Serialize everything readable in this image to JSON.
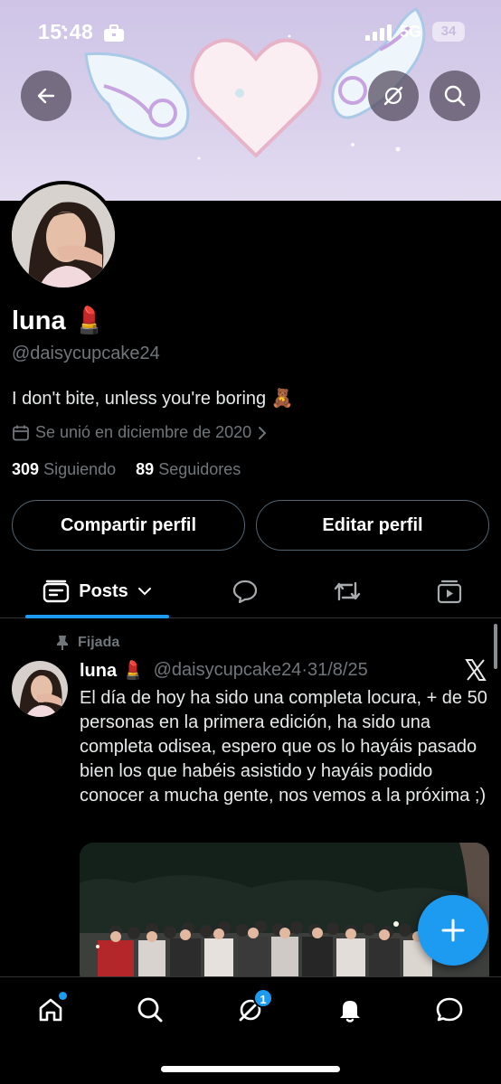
{
  "status_bar": {
    "time": "15:48",
    "network": "5G",
    "battery": "34"
  },
  "header": {
    "back_icon": "arrow-left-icon",
    "grok_icon": "grok-icon",
    "search_icon": "search-icon"
  },
  "profile": {
    "display_name": "luna 💄",
    "handle": "@daisycupcake24",
    "bio": "I don't bite, unless you're boring 🧸",
    "joined": "Se unió en diciembre de 2020",
    "following_count": "309",
    "following_label": "Siguiendo",
    "followers_count": "89",
    "followers_label": "Seguidores"
  },
  "actions": {
    "share_label": "Compartir perfil",
    "edit_label": "Editar perfil"
  },
  "tabs": {
    "posts_label": "Posts",
    "icons": [
      "chat-bubble-icon",
      "repost-icon",
      "media-icon"
    ]
  },
  "pinned_post": {
    "pinned_label": "Fijada",
    "author_name": "luna 💄",
    "author_handle": "@daisycupcake24",
    "separator": "·",
    "date": "31/8/25",
    "text": "El día de hoy ha sido una completa locura, + de 50 personas en la primera edición, ha sido una completa odisea, espero que os lo hayáis pasado bien los que habéis asistido y hayáis podido conocer a mucha gente, nos vemos a la próxima ;)"
  },
  "bottom_nav": {
    "messages_badge": "1",
    "icons": [
      "home-icon",
      "search-icon",
      "grok-icon",
      "bell-icon",
      "chat-icon"
    ]
  },
  "colors": {
    "accent": "#1d9bf0",
    "background": "#000000",
    "muted_text": "#71767b",
    "border": "#2f3336"
  }
}
